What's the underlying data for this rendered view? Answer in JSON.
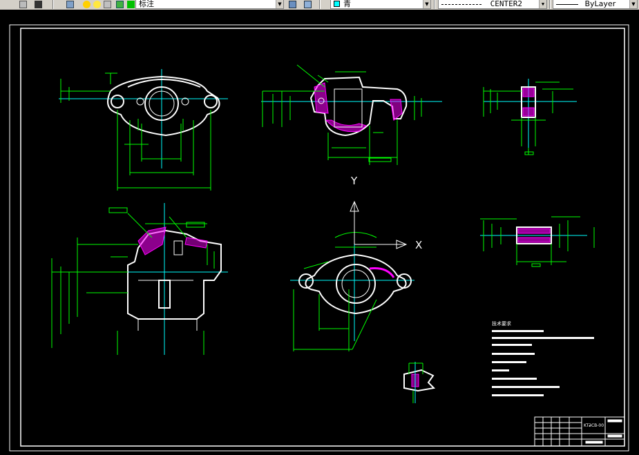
{
  "toolbar": {
    "dimstyle": {
      "value": "标注"
    },
    "color": {
      "value": "青",
      "swatch": "#00ffff"
    },
    "linetype": {
      "value": "CENTER2"
    },
    "lineweight": {
      "value": "ByLayer"
    }
  },
  "drawing": {
    "axis_y_label": "Y",
    "axis_x_label": "X",
    "notes_title": "技术要求",
    "title_block_code": "KT2̶CB-00"
  },
  "colors": {
    "background": "#000000",
    "outline": "#ffffff",
    "dimension": "#00ff00",
    "centerline": "#00ffff",
    "hatch": "#ff00ff",
    "toolbar": "#d4d0c8"
  }
}
